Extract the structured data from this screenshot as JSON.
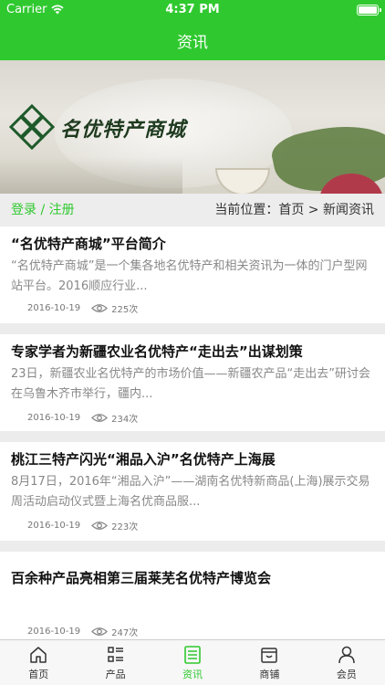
{
  "status_bar": {
    "carrier": "Carrier",
    "time": "4:37 PM",
    "battery_level": 1.0
  },
  "header": {
    "title": "资讯"
  },
  "banner": {
    "logo_text": "名优特产商城",
    "icon": "diamond-logo-icon"
  },
  "crumb_bar": {
    "login": "登录",
    "separator": " / ",
    "register": "注册",
    "location": "当前位置：首页 > 新闻资讯"
  },
  "articles": [
    {
      "title": "“名优特产商城”平台简介",
      "summary": "“名优特产商城”是一个集各地名优特产和相关资讯为一体的门户型网站平台。2016顺应行业...",
      "date": "2016-10-19",
      "views": "225次"
    },
    {
      "title": "专家学者为新疆农业名优特产“走出去”出谋划策",
      "summary": "23日，新疆农业名优特产的市场价值——新疆农产品“走出去”研讨会在乌鲁木齐市举行，疆内...",
      "date": "2016-10-19",
      "views": "234次"
    },
    {
      "title": "桃江三特产闪光“湘品入沪”名优特产上海展",
      "summary": "8月17日，2016年“湘品入沪”——湖南名优特新商品(上海)展示交易周活动启动仪式暨上海名优商品服...",
      "date": "2016-10-19",
      "views": "223次"
    },
    {
      "title": "百余种产品亮相第三届莱芜名优特产博览会",
      "summary": "",
      "date": "2016-10-19",
      "views": "247次"
    }
  ],
  "tabs": [
    {
      "label": "首页",
      "icon": "home-icon",
      "active": false
    },
    {
      "label": "产品",
      "icon": "list-icon",
      "active": false
    },
    {
      "label": "资讯",
      "icon": "news-icon",
      "active": true
    },
    {
      "label": "商铺",
      "icon": "store-icon",
      "active": false
    },
    {
      "label": "会员",
      "icon": "user-icon",
      "active": false
    }
  ],
  "colors": {
    "accent": "#2fc92f",
    "background": "#ececec"
  }
}
